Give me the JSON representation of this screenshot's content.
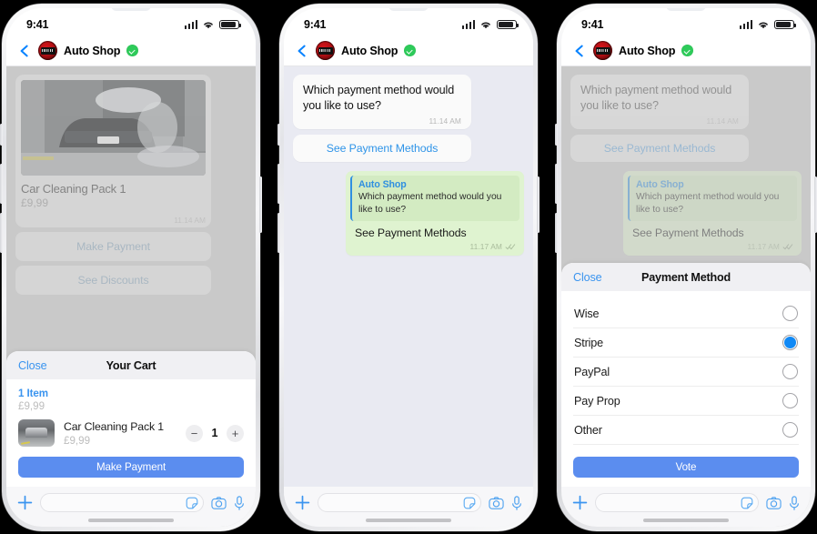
{
  "background_color": "#000000",
  "accent": {
    "ios_blue": "#3a94ef",
    "button_blue": "#5b8def",
    "link_blue": "#2f94e8",
    "radio_blue": "#1089f5",
    "verified_green": "#2ecb5a",
    "out_bubble_green": "#dff3d0",
    "chat_bg": "#e9eaf2",
    "dim_grey": "#c9c9c9"
  },
  "status_bar": {
    "time": "9:41",
    "signal_icon": "cellular-bars-icon",
    "wifi_icon": "wifi-icon",
    "battery_icon": "battery-icon"
  },
  "nav_bar": {
    "back_icon": "back-chevron-icon",
    "avatar_icon": "auto-shop-avatar",
    "title": "Auto Shop",
    "verified_icon": "verified-badge-icon"
  },
  "phone1": {
    "product_card": {
      "image_icon": "car-wash-photo",
      "name": "Car Cleaning Pack 1",
      "price": "£9,99",
      "time": "11.14 AM"
    },
    "quick_actions": [
      {
        "label": "Make Payment"
      },
      {
        "label": "See Discounts"
      }
    ],
    "sheet": {
      "close_label": "Close",
      "title": "Your Cart",
      "item_count": "1 Item",
      "total": "£9,99",
      "item": {
        "thumb_icon": "car-wash-thumbnail",
        "name": "Car Cleaning Pack 1",
        "price": "£9,99",
        "minus_label": "−",
        "quantity": "1",
        "plus_label": "+"
      },
      "cta_label": "Make Payment"
    }
  },
  "phone2": {
    "incoming_message": {
      "text": "Which payment method would you like to use?",
      "time": "11.14 AM"
    },
    "action_bubble": {
      "label": "See Payment Methods"
    },
    "outgoing_message": {
      "quote_name": "Auto Shop",
      "quote_text": "Which payment method would you like to use?",
      "text": "See Payment Methods",
      "time": "11.17 AM",
      "status_icon": "double-check-icon"
    }
  },
  "phone3": {
    "incoming_message": {
      "text": "Which payment method would you like to use?",
      "time": "11.14 AM"
    },
    "action_bubble": {
      "label": "See Payment Methods"
    },
    "outgoing_message": {
      "quote_name": "Auto Shop",
      "quote_text": "Which payment method would you like to use?",
      "text": "See Payment Methods",
      "time": "11.17 AM",
      "status_icon": "double-check-icon"
    },
    "sheet": {
      "close_label": "Close",
      "title": "Payment Method",
      "options": [
        {
          "label": "Wise",
          "selected": false
        },
        {
          "label": "Stripe",
          "selected": true
        },
        {
          "label": "PayPal",
          "selected": false
        },
        {
          "label": "Pay Prop",
          "selected": false
        },
        {
          "label": "Other",
          "selected": false
        }
      ],
      "cta_label": "Vote"
    }
  },
  "input_bar": {
    "plus_icon": "plus-icon",
    "placeholder": "",
    "sticker_icon": "sticker-icon",
    "camera_icon": "camera-icon",
    "mic_icon": "microphone-icon"
  }
}
